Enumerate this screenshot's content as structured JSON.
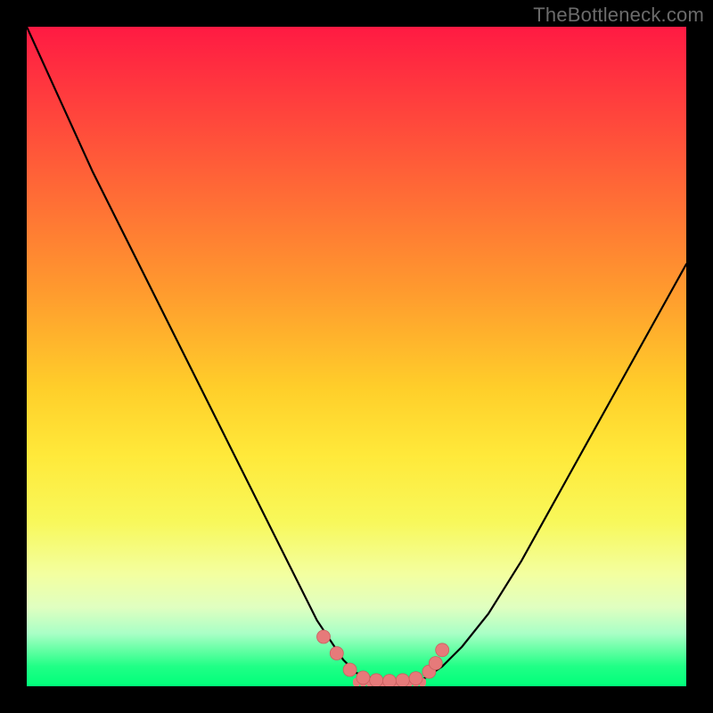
{
  "watermark": "TheBottleneck.com",
  "colors": {
    "background": "#000000",
    "curve": "#000000",
    "marker": "#e67a7a",
    "gradient_top": "#ff1a43",
    "gradient_bottom": "#00ff7a"
  },
  "chart_data": {
    "type": "line",
    "title": "",
    "xlabel": "",
    "ylabel": "",
    "xlim": [
      0,
      100
    ],
    "ylim": [
      0,
      100
    ],
    "grid": false,
    "background_gradient": "vertical red→orange→yellow→green",
    "series": [
      {
        "name": "left-branch",
        "style": "line",
        "x": [
          0,
          5,
          10,
          15,
          20,
          25,
          30,
          35,
          40,
          44,
          48,
          50,
          53
        ],
        "y": [
          100,
          89,
          78,
          68,
          58,
          48,
          38,
          28,
          18,
          10,
          4,
          2,
          1
        ]
      },
      {
        "name": "right-branch",
        "style": "line",
        "x": [
          60,
          63,
          66,
          70,
          75,
          80,
          85,
          90,
          95,
          100
        ],
        "y": [
          1,
          3,
          6,
          11,
          19,
          28,
          37,
          46,
          55,
          64
        ]
      },
      {
        "name": "floor-segment",
        "style": "bar-thin",
        "x": [
          50,
          51,
          52,
          53,
          54,
          55,
          56,
          57,
          58,
          59,
          60
        ],
        "y": [
          1.2,
          1.0,
          0.9,
          0.85,
          0.8,
          0.8,
          0.85,
          0.9,
          1.0,
          1.1,
          1.2
        ]
      },
      {
        "name": "markers",
        "style": "scatter",
        "x": [
          45,
          47,
          49,
          51,
          53,
          55,
          57,
          59,
          61,
          62,
          63
        ],
        "y": [
          7.5,
          5,
          2.5,
          1.3,
          0.9,
          0.8,
          0.9,
          1.2,
          2.2,
          3.5,
          5.5
        ]
      }
    ],
    "annotations": [
      {
        "text": "TheBottleneck.com",
        "position": "top-right"
      }
    ]
  }
}
